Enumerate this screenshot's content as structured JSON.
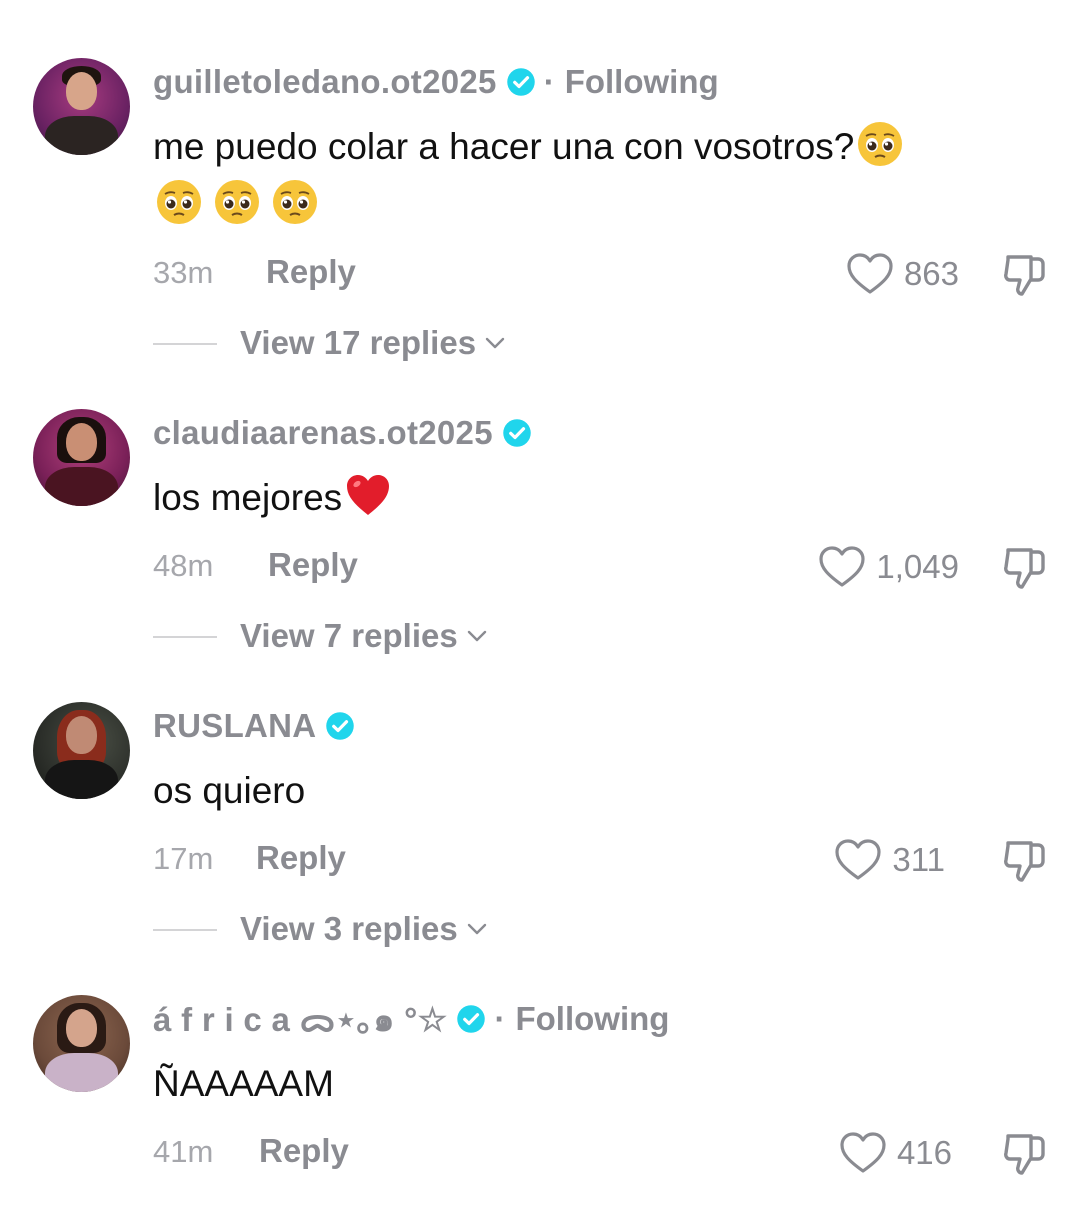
{
  "comments": [
    {
      "username": "guilletoledano.ot2025",
      "verified": true,
      "following": "Following",
      "text": "me puedo colar a hacer una con vosotros?",
      "time": "33m",
      "reply_label": "Reply",
      "likes": "863",
      "view_replies": "View 17 replies",
      "avatar_colors": {
        "bg": "#7a2a6e",
        "skin": "#d7a58a",
        "hair": "#1e140f",
        "shirt": "#2b2422"
      }
    },
    {
      "username": "claudiaarenas.ot2025",
      "verified": true,
      "following": "",
      "text": "los mejores",
      "time": "48m",
      "reply_label": "Reply",
      "likes": "1,049",
      "view_replies": "View 7 replies",
      "avatar_colors": {
        "bg": "#8b2d64",
        "skin": "#c98f74",
        "hair": "#1a0f0d",
        "shirt": "#4a1421"
      }
    },
    {
      "username": "RUSLANA",
      "verified": true,
      "following": "",
      "text": "os quiero",
      "time": "17m",
      "reply_label": "Reply",
      "likes": "311",
      "view_replies": "View 3 replies",
      "avatar_colors": {
        "bg": "#2c2f2a",
        "skin": "#c08a74",
        "hair": "#8a2c1c",
        "shirt": "#151515"
      }
    },
    {
      "username": "á f r i c a ᯅ⋆｡๑ °☆",
      "verified": true,
      "following": "Following",
      "text": "ÑAAAAAM",
      "time": "41m",
      "reply_label": "Reply",
      "likes": "416",
      "view_replies": "",
      "avatar_colors": {
        "bg": "#6b4a3a",
        "skin": "#d4a48c",
        "hair": "#2a1a14",
        "shirt": "#c9b2c8"
      }
    }
  ],
  "separator": "·",
  "colors": {
    "secondary_text": "#8a8b91",
    "verified_badge": "#20d5ec",
    "heart_outline": "#8a8b91",
    "emoji_face": "#f7c53a",
    "heart_emoji": "#e21d2b"
  },
  "icons": {
    "verified": "verified-badge-icon",
    "like": "heart-outline-icon",
    "dislike": "thumbs-down-icon",
    "expand": "chevron-down-icon",
    "emoji_pleading": "pleading-face-emoji",
    "emoji_heart": "red-heart-emoji"
  }
}
